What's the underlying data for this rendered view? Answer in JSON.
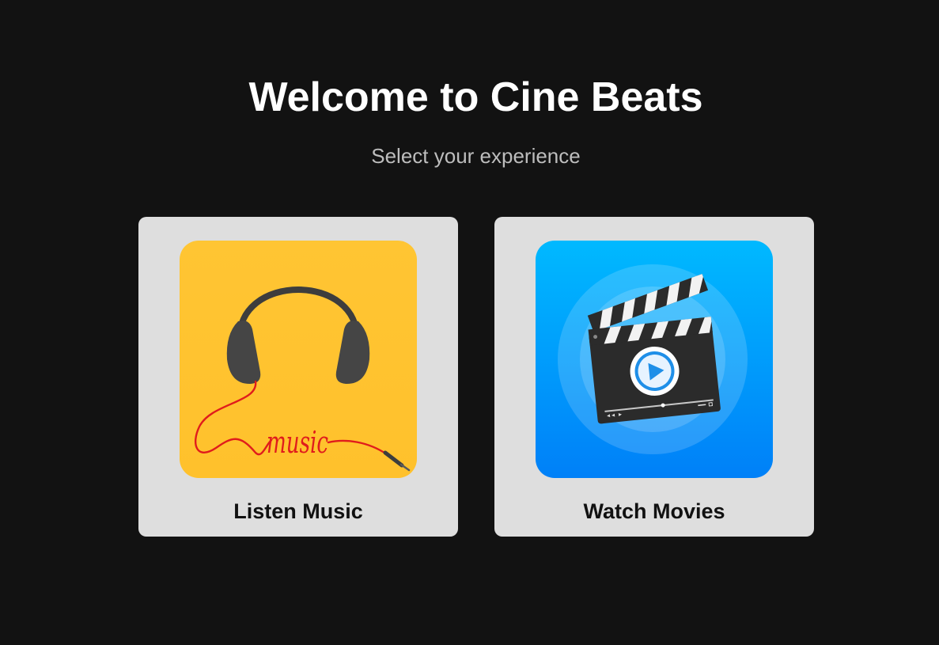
{
  "header": {
    "title": "Welcome to Cine Beats",
    "subtitle": "Select your experience"
  },
  "options": [
    {
      "label": "Listen Music",
      "icon": "headphones-music-icon",
      "artwork_text": "music",
      "background": "#FFC533"
    },
    {
      "label": "Watch Movies",
      "icon": "clapperboard-play-icon",
      "background": "#0A8DF7"
    }
  ],
  "colors": {
    "page_background": "#121212",
    "card_background": "#DEDEDE",
    "title": "#FFFFFF",
    "subtitle": "#BDBDBD"
  }
}
